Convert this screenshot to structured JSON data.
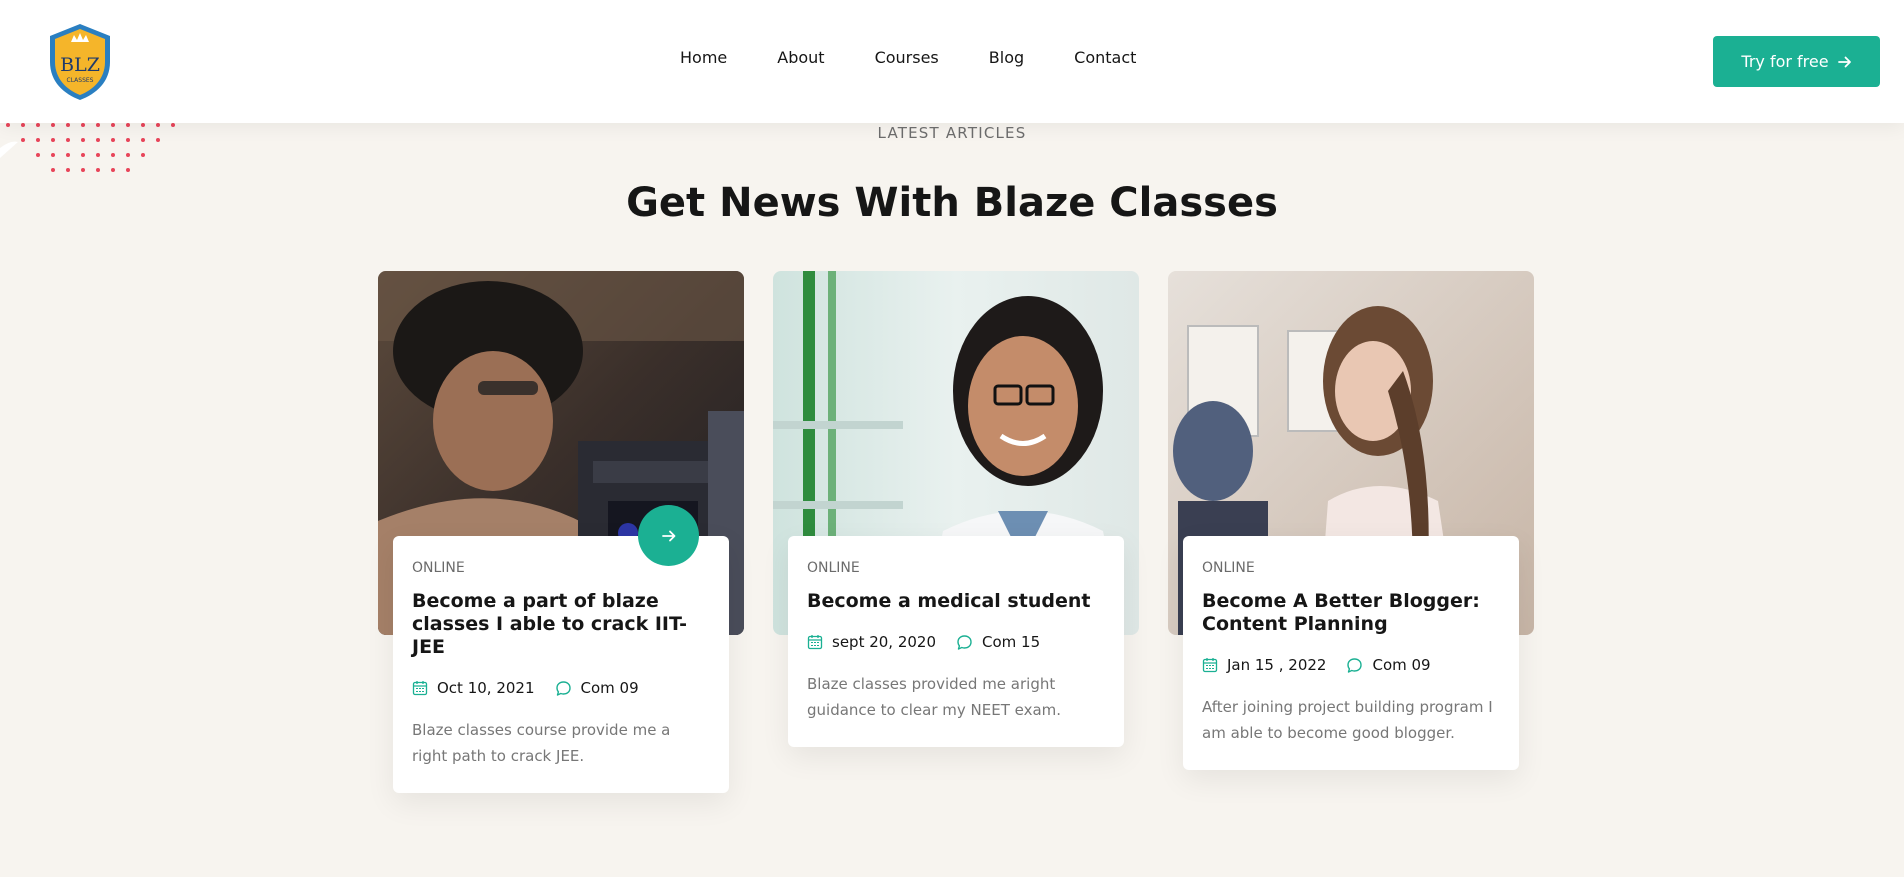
{
  "header": {
    "logo_text": "BLZ",
    "logo_sub": "CLASSES",
    "nav": [
      "Home",
      "About",
      "Courses",
      "Blog",
      "Contact"
    ],
    "cta_label": "Try for free"
  },
  "section": {
    "eyebrow": "LATEST ARTICLES",
    "title": "Get News With Blaze Classes"
  },
  "cards": [
    {
      "tag": "ONLINE",
      "title": "Become a part of blaze classes I able to crack IIT-JEE",
      "date": "Oct 10, 2021",
      "comments": "Com 09",
      "desc": "Blaze classes course provide me a right path to crack JEE."
    },
    {
      "tag": "ONLINE",
      "title": "Become a medical student",
      "date": "sept 20, 2020",
      "comments": "Com 15",
      "desc": "Blaze classes provided me aright guidance to clear my NEET exam."
    },
    {
      "tag": "ONLINE",
      "title": "Become A Better Blogger: Content Planning",
      "date": "Jan 15 , 2022",
      "comments": "Com 09",
      "desc": "After joining project building program I am able to become good blogger."
    }
  ],
  "colors": {
    "accent": "#1bb093",
    "background": "#f7f4ef",
    "logo_gold": "#f5b52a",
    "logo_blue": "#2a7fc1",
    "dots": "#e8455a"
  },
  "icons": [
    "calendar-icon",
    "comment-icon",
    "arrow-right-icon"
  ]
}
